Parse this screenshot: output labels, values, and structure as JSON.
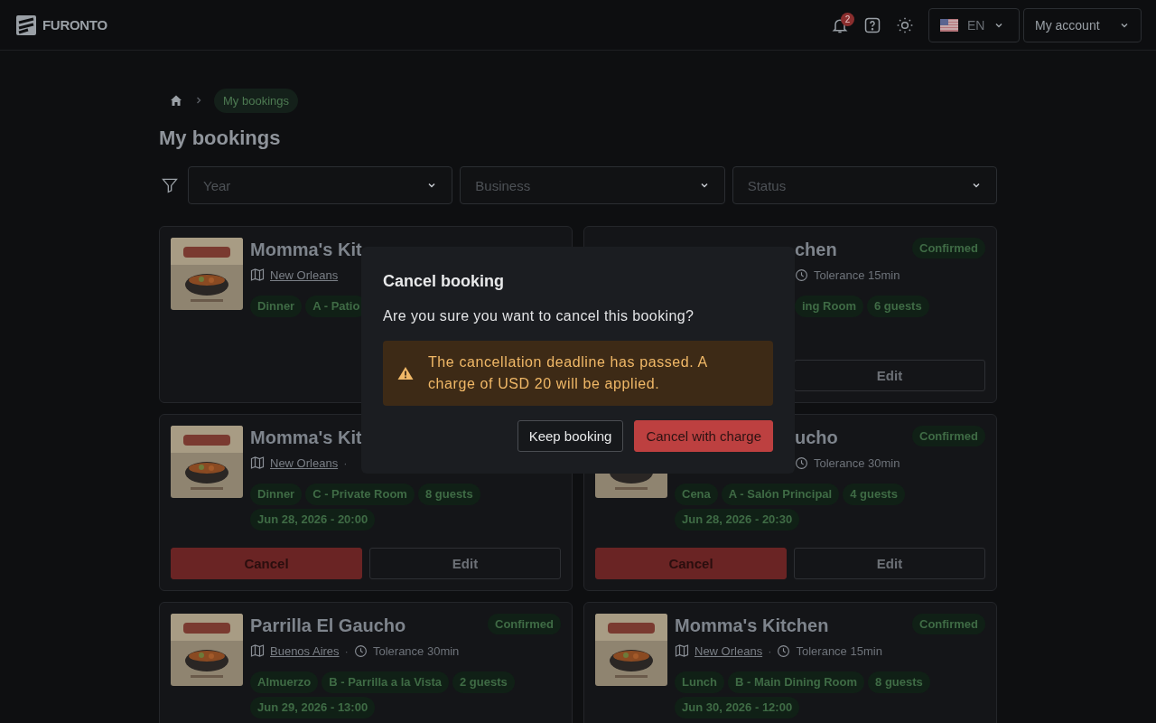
{
  "header": {
    "brand": "FURONTO",
    "notifications": "2",
    "language": "EN",
    "account": "My account"
  },
  "breadcrumb": [
    {
      "label": "My bookings",
      "selected": true
    }
  ],
  "title": "My bookings",
  "filters": [
    {
      "placeholder": "Year"
    },
    {
      "placeholder": "Business"
    },
    {
      "placeholder": "Status"
    }
  ],
  "cards": [
    {
      "kind": "cut-right",
      "picture": {
        "kind": "picture"
      },
      "title": "Momma's Kit",
      "meta": [
        {
          "kind": "location",
          "text": "New Orleans"
        }
      ],
      "tags": [
        "Dinner",
        "A - Patio"
      ]
    },
    {
      "kind": "cut-left",
      "title": "chen",
      "status": "Confirmed",
      "meta": [
        {
          "kind": "tolerance",
          "text": "Tolerance 15min"
        }
      ],
      "tags": [
        "ing Room",
        "6 guests"
      ],
      "buttons": [
        {
          "kind": "edit",
          "label": "Edit"
        }
      ]
    },
    {
      "kind": "cut-right",
      "picture": {
        "kind": "picture"
      },
      "title": "Momma's Kit",
      "meta": [
        {
          "kind": "location",
          "text": "New Orleans"
        },
        {
          "kind": "separator",
          "text": "·"
        }
      ],
      "tags": [
        "Dinner",
        "C - Private Room",
        "8 guests",
        "Jun 28, 2026 - 20:00"
      ],
      "buttons": [
        {
          "kind": "cancel",
          "label": "Cancel"
        },
        {
          "kind": "edit",
          "label": "Edit"
        }
      ]
    },
    {
      "kind": "cut-left-top",
      "picture": {
        "kind": "picture"
      },
      "title": "ucho",
      "status": "Confirmed",
      "meta": [
        {
          "kind": "tolerance",
          "text": "Tolerance 30min"
        }
      ],
      "tags": [
        "Cena",
        "A - Salón Principal",
        "4 guests",
        "Jun 28, 2026 - 20:30"
      ],
      "buttons": [
        {
          "kind": "cancel",
          "label": "Cancel"
        },
        {
          "kind": "edit",
          "label": "Edit"
        }
      ]
    },
    {
      "kind": "full",
      "picture": {
        "kind": "picture"
      },
      "title": "Parrilla El Gaucho",
      "status": "Confirmed",
      "meta": [
        {
          "kind": "location",
          "text": "Buenos Aires"
        },
        {
          "kind": "separator",
          "text": "·"
        },
        {
          "kind": "tolerance",
          "text": "Tolerance 30min"
        }
      ],
      "tags": [
        "Almuerzo",
        "B - Parrilla a la Vista",
        "2 guests",
        "Jun 29, 2026 - 13:00"
      ]
    },
    {
      "kind": "full",
      "picture": {
        "kind": "picture"
      },
      "title": "Momma's Kitchen",
      "status": "Confirmed",
      "meta": [
        {
          "kind": "location",
          "text": "New Orleans"
        },
        {
          "kind": "separator",
          "text": "·"
        },
        {
          "kind": "tolerance",
          "text": "Tolerance 15min"
        }
      ],
      "tags": [
        "Lunch",
        "B - Main Dining Room",
        "8 guests",
        "Jun 30, 2026 - 12:00"
      ]
    }
  ],
  "dialog": {
    "title": "Cancel booking",
    "message": "Are you sure you want to cancel this booking?",
    "warning": "The cancellation deadline has passed. A charge of USD 20 will be applied.",
    "buttons": [
      {
        "kind": "secondary",
        "label": "Keep booking"
      },
      {
        "kind": "danger",
        "label": "Cancel with charge"
      }
    ]
  }
}
